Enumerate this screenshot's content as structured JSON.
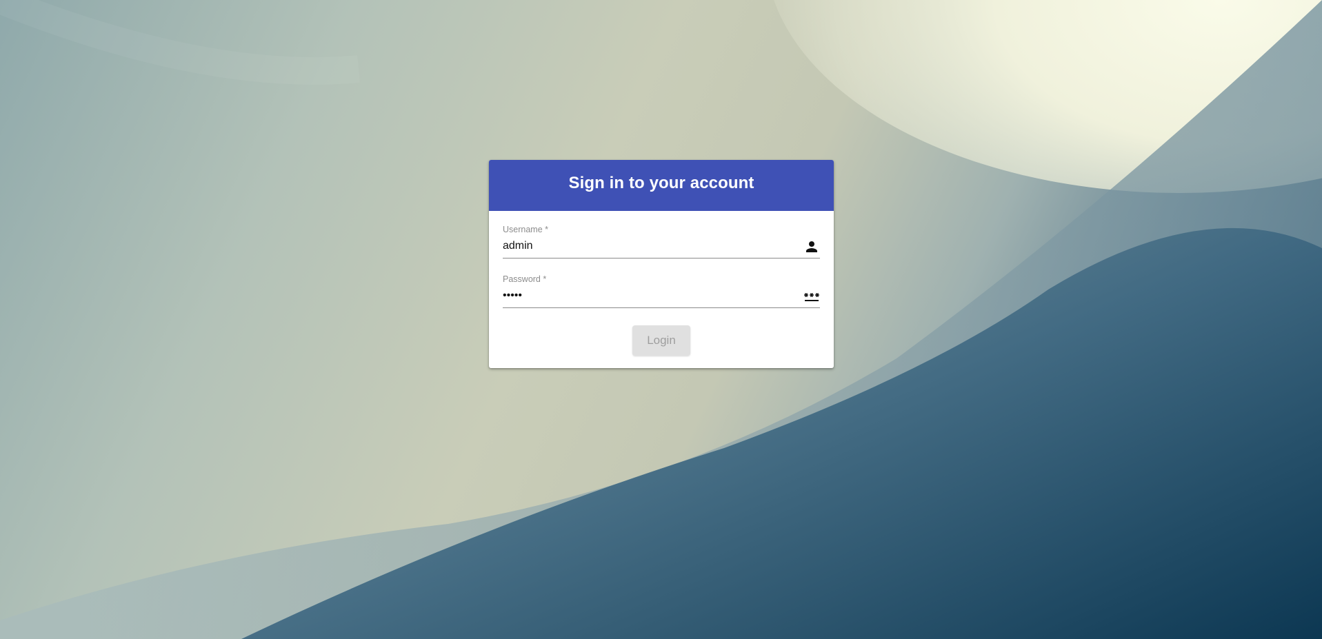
{
  "login": {
    "title": "Sign in to your account",
    "username": {
      "label": "Username *",
      "value": "admin",
      "icon": "person-icon"
    },
    "password": {
      "label": "Password *",
      "value": "•••••",
      "icon": "password-icon"
    },
    "submit_label": "Login"
  },
  "colors": {
    "header": "#3f51b5",
    "button_disabled_bg": "#e0e0e0",
    "button_disabled_text": "#9e9e9e"
  }
}
